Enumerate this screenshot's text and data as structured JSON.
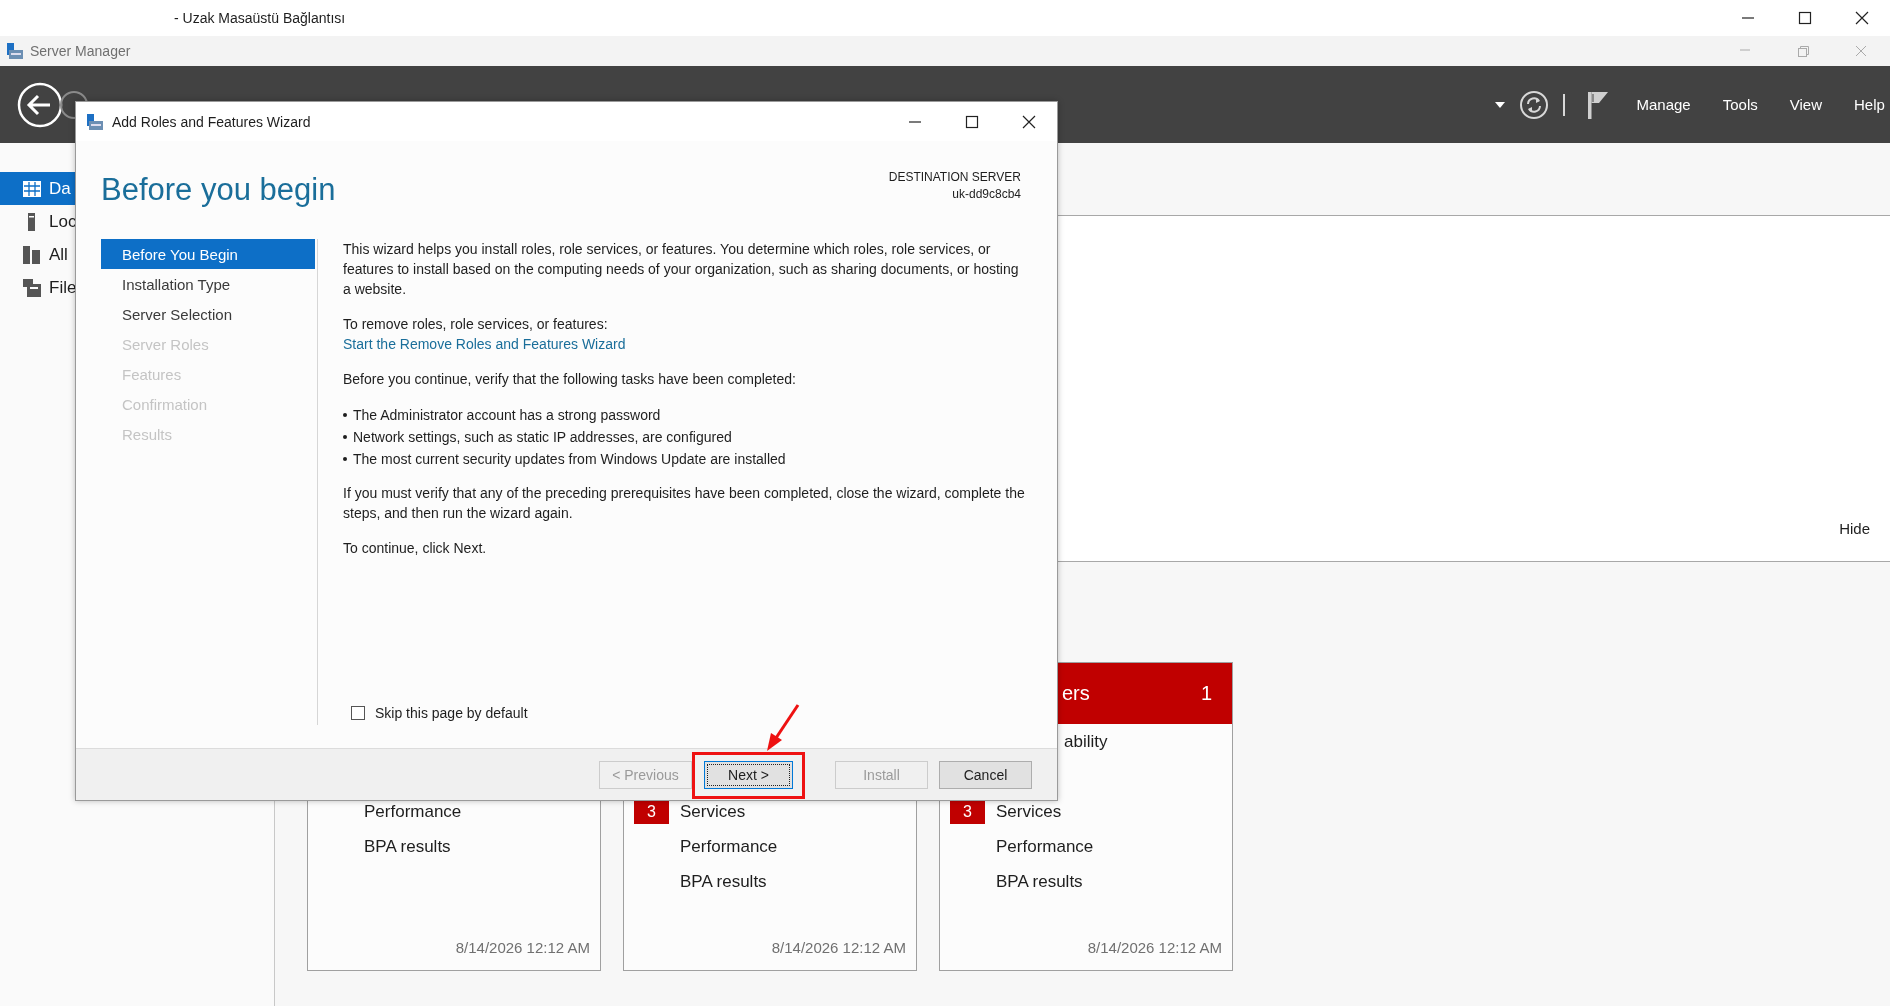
{
  "rdp_window": {
    "title": "- Uzak Masaüstü Bağlantısı"
  },
  "server_manager": {
    "title": "Server Manager",
    "menu": [
      "Manage",
      "Tools",
      "View",
      "Help"
    ],
    "sidebar": [
      {
        "label": "Da",
        "kind": "dashboard",
        "selected": true
      },
      {
        "label": "Loc",
        "kind": "server",
        "selected": false
      },
      {
        "label": "All",
        "kind": "servers",
        "selected": false
      },
      {
        "label": "File",
        "kind": "files",
        "selected": false
      }
    ],
    "welcome": {
      "hide_link": "Hide"
    },
    "tiles": [
      {
        "rows": [
          {
            "kind": "row",
            "label": "Performance"
          },
          {
            "kind": "row",
            "label": "BPA results"
          }
        ],
        "timestamp": "8/14/2026 12:12 AM"
      },
      {
        "rows": [
          {
            "kind": "row",
            "label": "Services",
            "badge": "3"
          },
          {
            "kind": "row",
            "label": "Performance"
          },
          {
            "kind": "row",
            "label": "BPA results"
          }
        ],
        "timestamp": "8/14/2026 12:12 AM"
      },
      {
        "header": {
          "title": "ers",
          "count": "1"
        },
        "rows": [
          {
            "kind": "cut",
            "label": "ability"
          },
          {
            "kind": "row",
            "label": "Services",
            "badge": "3"
          },
          {
            "kind": "row",
            "label": "Performance"
          },
          {
            "kind": "row",
            "label": "BPA results"
          }
        ],
        "timestamp": "8/14/2026 12:12 AM"
      }
    ]
  },
  "wizard": {
    "title": "Add Roles and Features Wizard",
    "heading": "Before you begin",
    "destination": {
      "label": "DESTINATION SERVER",
      "server": "uk-dd9c8cb4"
    },
    "steps": [
      {
        "label": "Before You Begin",
        "selected": true,
        "disabled": false
      },
      {
        "label": "Installation Type",
        "selected": false,
        "disabled": false
      },
      {
        "label": "Server Selection",
        "selected": false,
        "disabled": false
      },
      {
        "label": "Server Roles",
        "selected": false,
        "disabled": true
      },
      {
        "label": "Features",
        "selected": false,
        "disabled": true
      },
      {
        "label": "Confirmation",
        "selected": false,
        "disabled": true
      },
      {
        "label": "Results",
        "selected": false,
        "disabled": true
      }
    ],
    "content": [
      {
        "kind": "paragraph",
        "text": "This wizard helps you install roles, role services, or features. You determine which roles, role services, or features to install based on the computing needs of your organization, such as sharing documents, or hosting a website."
      },
      {
        "kind": "paragraph",
        "text": "To remove roles, role services, or features:"
      },
      {
        "kind": "link",
        "text": "Start the Remove Roles and Features Wizard"
      },
      {
        "kind": "paragraph",
        "text": "Before you continue, verify that the following tasks have been completed:"
      },
      {
        "kind": "bullets",
        "items": [
          "The Administrator account has a strong password",
          "Network settings, such as static IP addresses, are configured",
          "The most current security updates from Windows Update are installed"
        ]
      },
      {
        "kind": "paragraph",
        "text": "If you must verify that any of the preceding prerequisites have been completed, close the wizard, complete the steps, and then run the wizard again."
      },
      {
        "kind": "paragraph",
        "text": "To continue, click Next."
      }
    ],
    "skip_checkbox": {
      "label": "Skip this page by default",
      "checked": false
    },
    "buttons": [
      {
        "label": "< Previous",
        "disabled": true,
        "focused": false
      },
      {
        "label": "Next >",
        "disabled": false,
        "focused": true
      },
      {
        "label": "Install",
        "disabled": true,
        "focused": false
      },
      {
        "label": "Cancel",
        "disabled": false,
        "focused": false
      }
    ]
  }
}
